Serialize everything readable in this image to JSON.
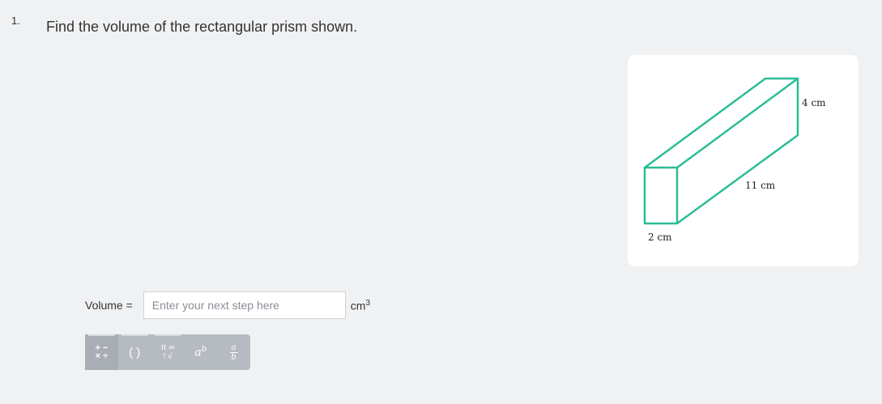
{
  "question": {
    "number": "1.",
    "prompt": "Find the volume of the rectangular prism shown."
  },
  "figure": {
    "labels": {
      "height": "4 cm",
      "length": "11 cm",
      "width": "2 cm"
    },
    "stroke_color": "#2bbd96"
  },
  "answer": {
    "label": "Volume =",
    "placeholder": "Enter your next step here",
    "value": "",
    "unit": "cm",
    "unit_exponent": "3"
  },
  "toolbar": {
    "buttons": [
      {
        "icon": "operators-icon",
        "line1": "+ −",
        "line2": "× ÷"
      },
      {
        "icon": "parentheses-icon",
        "text": "( )"
      },
      {
        "icon": "symbols-icon",
        "line1": "π ∞",
        "line2": "! √"
      },
      {
        "icon": "exponent-icon",
        "base": "a",
        "exp": "b"
      },
      {
        "icon": "fraction-icon",
        "num": "a",
        "den": "b"
      }
    ]
  }
}
